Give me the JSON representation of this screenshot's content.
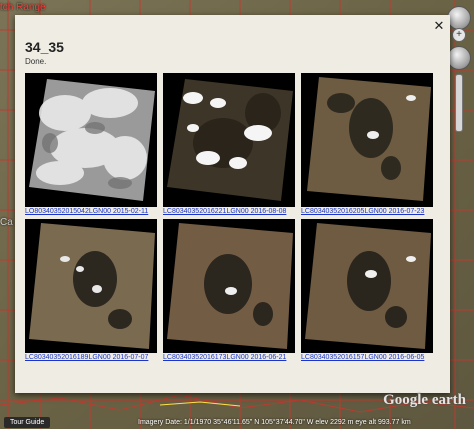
{
  "map": {
    "label_range": "tch Range",
    "label_ca": "Ca"
  },
  "balloon": {
    "close_icon": "close-icon",
    "title": "34_35",
    "status": "Done.",
    "images": [
      {
        "caption": "LO80340352015042LGN00 2015-02-11",
        "scene": "cloudy"
      },
      {
        "caption": "LC80340352016221LGN00 2016-08-08",
        "scene": "dark-clouds"
      },
      {
        "caption": "LC80340352016205LGN00 2016-07-23",
        "scene": "terrain"
      },
      {
        "caption": "LC80340352016189LGN00 2016-07-07",
        "scene": "terrain-light"
      },
      {
        "caption": "LC80340352016173LGN00 2016-06-21",
        "scene": "terrain"
      },
      {
        "caption": "LC80340352016157LGN00 2016-06-05",
        "scene": "terrain"
      }
    ]
  },
  "bottom": {
    "tour_guide": "Tour Guide",
    "status_text": "Imagery Date: 1/1/1970     35°46'11.65\" N   105°37'44.70\" W   elev  2292 m      eye alt 993.77 km",
    "logo": "Google earth"
  },
  "colors": {
    "terrain": "#6b5a40",
    "dark_patch": "#2a2a22",
    "cloud": "#f2f2f2"
  }
}
